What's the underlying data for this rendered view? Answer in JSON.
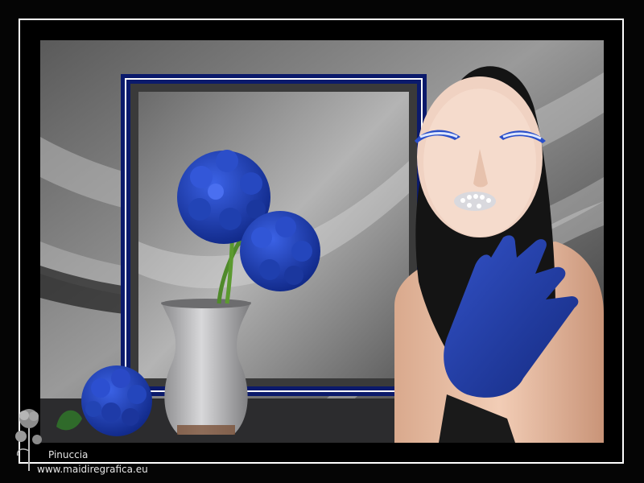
{
  "artwork": {
    "signature": {
      "name": "Pinuccia",
      "url": "www.maidiregrafica.eu"
    }
  },
  "colors": {
    "frame_white": "#ffffff",
    "navy_border": "#0b1a6b",
    "hydrangea_blue": "#1c3fb8",
    "glove_blue": "#1f3a9e",
    "hood_black": "#141414",
    "background_grey": "#8a8a8a"
  }
}
